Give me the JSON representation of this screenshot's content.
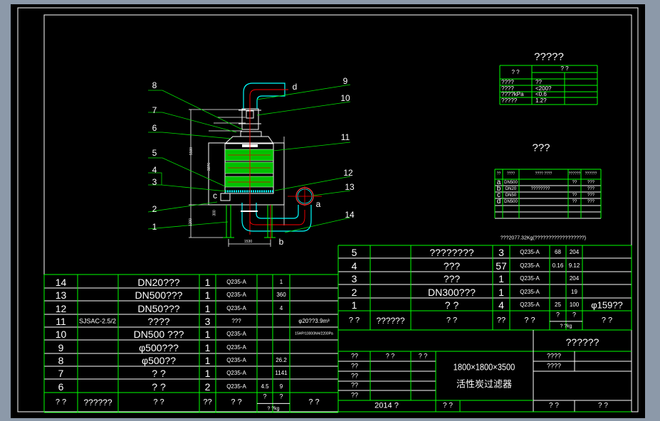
{
  "colors": {
    "background": "#000000",
    "frame": "#ffffff",
    "grid": "#00ff00",
    "duct": "#00ffff",
    "centerline": "#ff0000",
    "filter_bed": "#00c800"
  },
  "drawing": {
    "callouts": [
      "1",
      "2",
      "3",
      "4",
      "5",
      "6",
      "7",
      "8",
      "9",
      "10",
      "11",
      "12",
      "13",
      "14"
    ],
    "nozzles": {
      "a": "a",
      "b": "b",
      "c": "c",
      "d": "d"
    },
    "dimensions": {
      "overall_height": "5500",
      "body_height": "3276",
      "bottom_width": "1530",
      "leg_height": "1200",
      "base": "300"
    }
  },
  "spec_table": {
    "title": "?????",
    "header": {
      "item": "?    ?",
      "value": "?     ?"
    },
    "rows": [
      {
        "item": "????",
        "value": "??"
      },
      {
        "item": "????",
        "value": "<200?"
      },
      {
        "item": "????kPa",
        "value": "<0.6"
      },
      {
        "item": "?????",
        "value": "1.2?"
      }
    ]
  },
  "nozzle_table": {
    "title": "???",
    "header": [
      "??",
      "????",
      "????  ????",
      "??????",
      "??????"
    ],
    "rows": [
      [
        "a",
        "DN500",
        "",
        "??",
        "???"
      ],
      [
        "b",
        "DN20",
        "????????",
        "",
        "???"
      ],
      [
        "c",
        "DN50",
        "",
        "??",
        "???"
      ],
      [
        "d",
        "DN500",
        "",
        "??",
        "???"
      ],
      [
        "",
        "",
        "",
        "",
        ""
      ],
      [
        "",
        "",
        "",
        "",
        ""
      ]
    ]
  },
  "weight_note": "???2077.32Kg(??????????????????)",
  "parts_left": {
    "rows": [
      {
        "no": "14",
        "code": "",
        "name": "DN20???",
        "qty": "1",
        "material": "Q235-A",
        "unit": "",
        "total": "1",
        "note": ""
      },
      {
        "no": "13",
        "code": "",
        "name": "DN500???",
        "qty": "1",
        "material": "Q235-A",
        "unit": "",
        "total": "360",
        "note": ""
      },
      {
        "no": "12",
        "code": "",
        "name": "DN50???",
        "qty": "1",
        "material": "Q235-A",
        "unit": "",
        "total": "4",
        "note": ""
      },
      {
        "no": "11",
        "code": "SJSAC-2.5/2",
        "name": "????",
        "qty": "3",
        "material": "???",
        "unit": "",
        "total": "",
        "note": "φ20??3.9m³"
      },
      {
        "no": "10",
        "code": "",
        "name": "DN500 ???",
        "qty": "1",
        "material": "Q235-A",
        "unit": "",
        "total": "",
        "note": "15HP/10000NH/2200Pa"
      },
      {
        "no": "9",
        "code": "",
        "name": "φ500???",
        "qty": "1",
        "material": "Q235-A",
        "unit": "",
        "total": "",
        "note": ""
      },
      {
        "no": "8",
        "code": "",
        "name": "φ500??",
        "qty": "1",
        "material": "Q235-A",
        "unit": "",
        "total": "26.2",
        "note": ""
      },
      {
        "no": "7",
        "code": "",
        "name": "?    ?",
        "qty": "1",
        "material": "Q235-A",
        "unit": "",
        "total": "1141",
        "note": ""
      },
      {
        "no": "6",
        "code": "",
        "name": "?    ?",
        "qty": "2",
        "material": "Q235-A",
        "unit": "4.5",
        "total": "9",
        "note": ""
      }
    ],
    "header": {
      "no": "?   ?",
      "code": "??????",
      "name": "?    ?",
      "qty": "??",
      "material": "?   ?",
      "unit": "?",
      "total": "?",
      "weight_unit": "? ?kg",
      "note": "?   ?"
    }
  },
  "parts_right": {
    "rows": [
      {
        "no": "5",
        "code": "",
        "name": "????????",
        "qty": "3",
        "material": "Q235-A",
        "unit": "68",
        "total": "204",
        "note": ""
      },
      {
        "no": "4",
        "code": "",
        "name": "???",
        "qty": "57",
        "material": "Q235-A",
        "unit": "0.16",
        "total": "9.12",
        "note": ""
      },
      {
        "no": "3",
        "code": "",
        "name": "???",
        "qty": "1",
        "material": "Q235-A",
        "unit": "",
        "total": "204",
        "note": ""
      },
      {
        "no": "2",
        "code": "",
        "name": "DN300???",
        "qty": "1",
        "material": "Q235-A",
        "unit": "",
        "total": "19",
        "note": ""
      },
      {
        "no": "1",
        "code": "",
        "name": "?      ?",
        "qty": "4",
        "material": "Q235-A",
        "unit": "25",
        "total": "100",
        "note": "φ159??"
      }
    ],
    "header": {
      "no": "?   ?",
      "code": "??????",
      "name": "?    ?",
      "qty": "??",
      "material": "?   ?",
      "unit": "?",
      "total": "?",
      "weight_unit": "? ?kg",
      "note": "?   ?"
    }
  },
  "title_block": {
    "company": "??????",
    "roles": [
      "??",
      "??",
      "??",
      "??",
      "??"
    ],
    "role_headers": [
      "?   ?",
      "?   ?"
    ],
    "drawing_title_line1": "1800×1800×3500",
    "drawing_title_line2": "活性炭过滤器",
    "info_labels": [
      "????",
      "????"
    ],
    "date": "2014  ?",
    "sheet_label": "? ?",
    "scale_label": "?    ?",
    "page_label": "?        ?"
  }
}
